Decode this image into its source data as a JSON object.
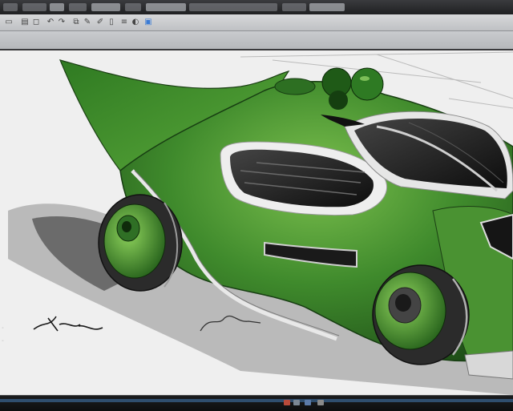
{
  "window": {
    "title_items": [
      "",
      "",
      "",
      "",
      "",
      "",
      "",
      ""
    ]
  },
  "toolbar": {
    "icons": [
      "new-icon",
      "open-icon",
      "save-icon",
      "undo-icon",
      "redo-icon",
      "copy-icon",
      "brush-icon",
      "pencil-icon",
      "eraser-icon",
      "layers-icon",
      "color-icon",
      "zoom-icon"
    ]
  },
  "canvas": {
    "artwork": "green-concept-car-sketch",
    "colors": {
      "body_green": "#3f8a2c",
      "dark_green": "#1e4d17",
      "light_green": "#7cc04e",
      "tire": "#2b2b2b",
      "background": "#efefef"
    }
  },
  "status_bar": {
    "accent": "#2f4e6e"
  }
}
